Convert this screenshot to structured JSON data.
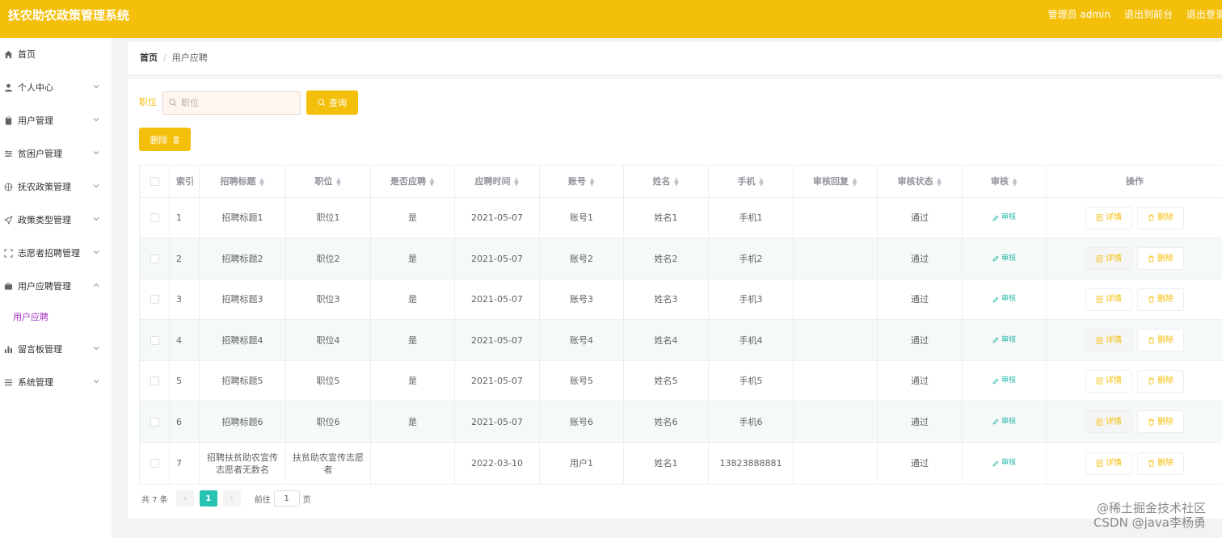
{
  "app": {
    "title": "抚农助农政策管理系统",
    "user_label": "管理员 admin",
    "frontend_link": "退出到前台",
    "logout_link": "退出登录",
    "accent_color": "#f4bf0a"
  },
  "sidebar": {
    "items": [
      {
        "label": "首页",
        "icon": "home-icon"
      },
      {
        "label": "个人中心",
        "icon": "person-icon"
      },
      {
        "label": "用户管理",
        "icon": "clipboard-icon"
      },
      {
        "label": "贫困户管理",
        "icon": "sliders-icon"
      },
      {
        "label": "抚农政策管理",
        "icon": "globe-icon"
      },
      {
        "label": "政策类型管理",
        "icon": "send-icon"
      },
      {
        "label": "志愿者招聘管理",
        "icon": "fullscreen-icon"
      },
      {
        "label": "用户应聘管理",
        "icon": "briefcase-icon"
      },
      {
        "label": "留言板管理",
        "icon": "bar-chart-icon"
      },
      {
        "label": "系统管理",
        "icon": "menu-icon"
      }
    ],
    "sub_item": "用户应聘"
  },
  "breadcrumb": {
    "home": "首页",
    "separator": "/",
    "current": "用户应聘"
  },
  "search": {
    "label": "职位",
    "placeholder": "职位",
    "value": "",
    "query_button": "查询"
  },
  "toolbar": {
    "delete_button": "删除"
  },
  "table": {
    "headers": {
      "index": "索引",
      "title": "招聘标题",
      "position": "职位",
      "hired": "是否应聘",
      "time": "应聘时间",
      "account": "账号",
      "name": "姓名",
      "phone": "手机",
      "reply": "审核回复",
      "status": "审核状态",
      "audit": "审核",
      "ops": "操作"
    },
    "audit_link": "审核",
    "detail_button": "详情",
    "remove_button": "删除",
    "rows": [
      {
        "index": "1",
        "title": "招聘标题1",
        "position": "职位1",
        "hired": "是",
        "time": "2021-05-07",
        "account": "账号1",
        "name": "姓名1",
        "phone": "手机1",
        "reply": "",
        "status": "通过"
      },
      {
        "index": "2",
        "title": "招聘标题2",
        "position": "职位2",
        "hired": "是",
        "time": "2021-05-07",
        "account": "账号2",
        "name": "姓名2",
        "phone": "手机2",
        "reply": "",
        "status": "通过"
      },
      {
        "index": "3",
        "title": "招聘标题3",
        "position": "职位3",
        "hired": "是",
        "time": "2021-05-07",
        "account": "账号3",
        "name": "姓名3",
        "phone": "手机3",
        "reply": "",
        "status": "通过"
      },
      {
        "index": "4",
        "title": "招聘标题4",
        "position": "职位4",
        "hired": "是",
        "time": "2021-05-07",
        "account": "账号4",
        "name": "姓名4",
        "phone": "手机4",
        "reply": "",
        "status": "通过"
      },
      {
        "index": "5",
        "title": "招聘标题5",
        "position": "职位5",
        "hired": "是",
        "time": "2021-05-07",
        "account": "账号5",
        "name": "姓名5",
        "phone": "手机5",
        "reply": "",
        "status": "通过"
      },
      {
        "index": "6",
        "title": "招聘标题6",
        "position": "职位6",
        "hired": "是",
        "time": "2021-05-07",
        "account": "账号6",
        "name": "姓名6",
        "phone": "手机6",
        "reply": "",
        "status": "通过"
      },
      {
        "index": "7",
        "title": "招聘扶贫助农宣传志愿者无数名",
        "position": "扶贫助农宣传志愿者",
        "hired": "",
        "time": "2022-03-10",
        "account": "用户1",
        "name": "姓名1",
        "phone": "13823888881",
        "reply": "",
        "status": "通过"
      }
    ]
  },
  "pagination": {
    "total": "共 7 条",
    "prev": "‹",
    "page": "1",
    "next": "›",
    "goto_prefix": "前往",
    "goto_value": "1",
    "goto_suffix": "页"
  },
  "watermark": {
    "line1": "@稀土掘金技术社区",
    "line2": "CSDN @java李杨勇"
  }
}
